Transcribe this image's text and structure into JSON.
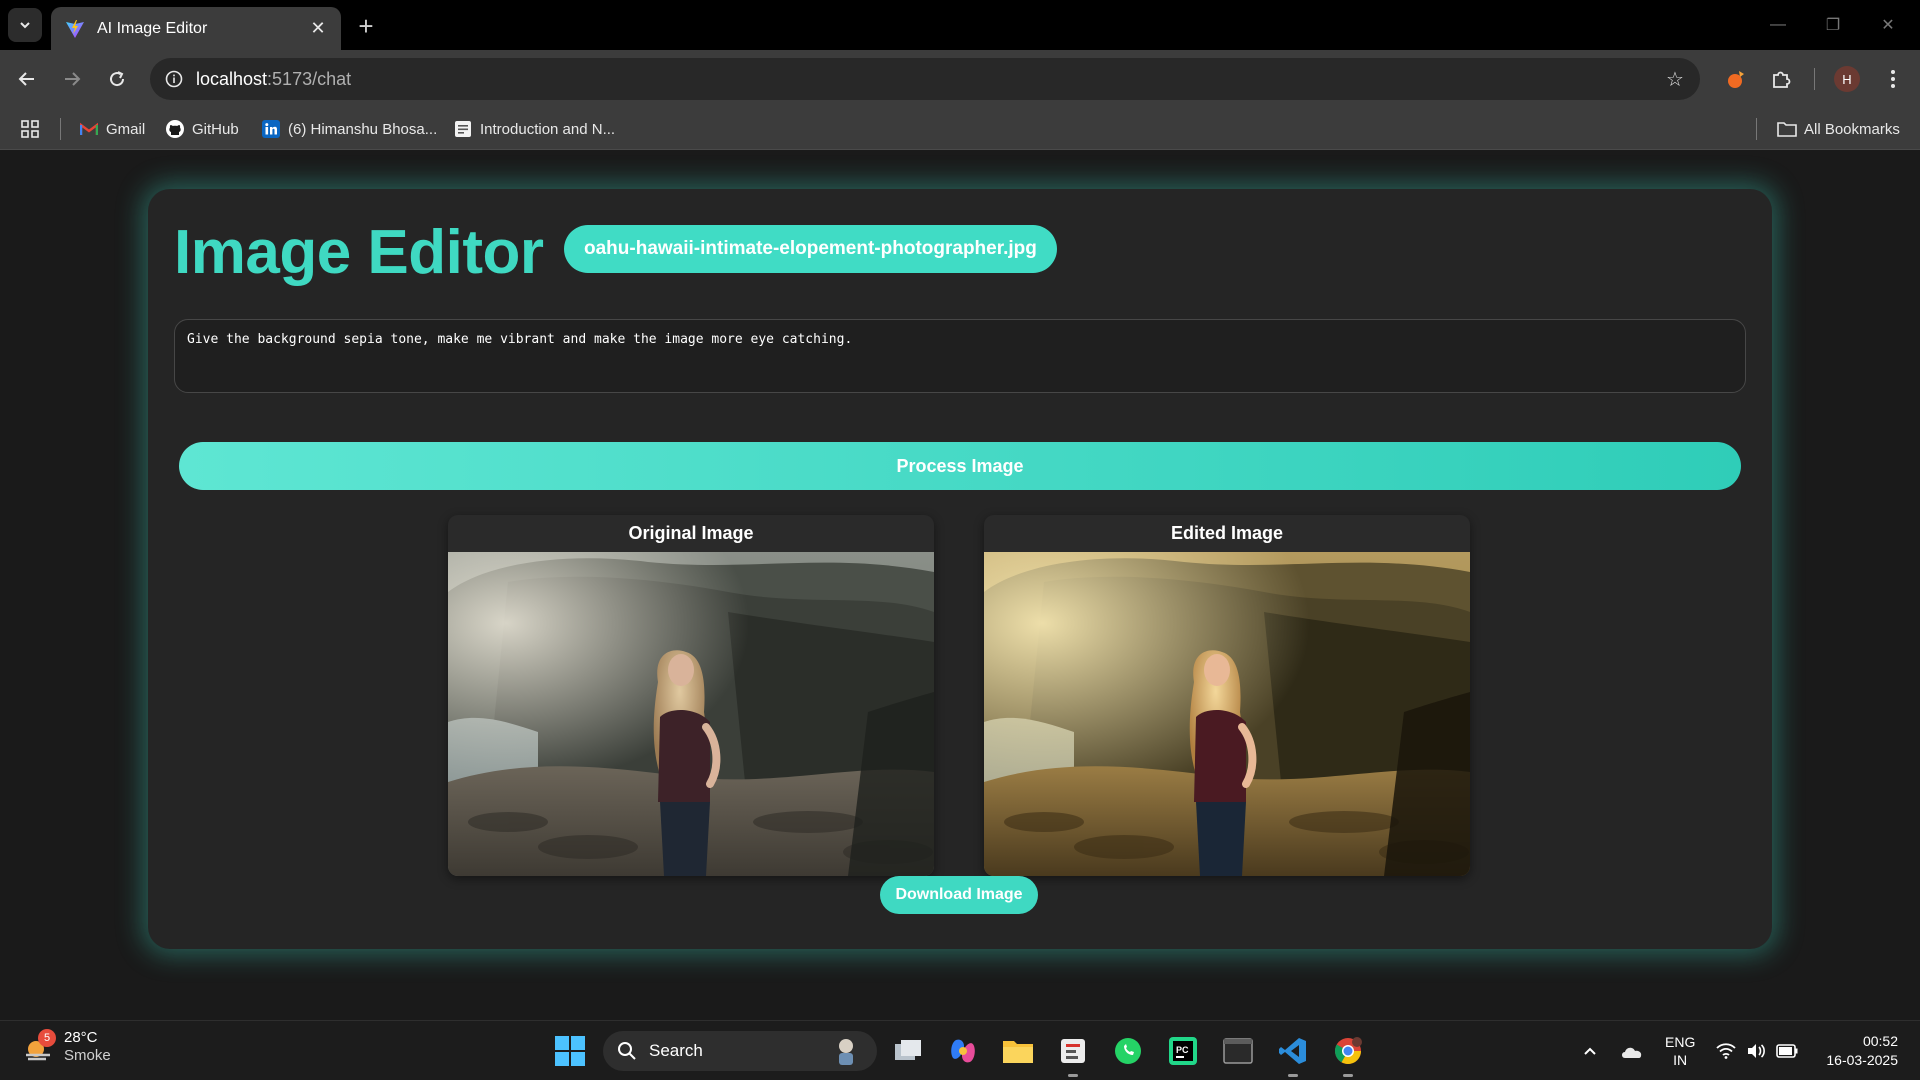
{
  "browser": {
    "tab_title": "AI Image Editor",
    "url_host": "localhost",
    "url_path": ":5173/chat",
    "profile_initial": "H",
    "bookmarks": [
      {
        "label": "Gmail",
        "icon": "gmail-icon"
      },
      {
        "label": "GitHub",
        "icon": "github-icon"
      },
      {
        "label": "(6) Himanshu Bhosa...",
        "icon": "linkedin-icon"
      },
      {
        "label": "Introduction and N...",
        "icon": "document-icon"
      }
    ],
    "all_bookmarks_label": "All Bookmarks"
  },
  "app": {
    "title": "Image Editor",
    "filename": "oahu-hawaii-intimate-elopement-photographer.jpg",
    "prompt": "Give the background sepia tone, make me vibrant and make the image more eye catching.",
    "process_label": "Process Image",
    "original_label": "Original Image",
    "edited_label": "Edited Image",
    "download_label": "Download Image",
    "accent_color": "#3fd9c2"
  },
  "taskbar": {
    "weather_temp": "28°C",
    "weather_cond": "Smoke",
    "weather_badge": "5",
    "search_label": "Search",
    "lang_line1": "ENG",
    "lang_line2": "IN",
    "time": "00:52",
    "date": "16-03-2025"
  }
}
